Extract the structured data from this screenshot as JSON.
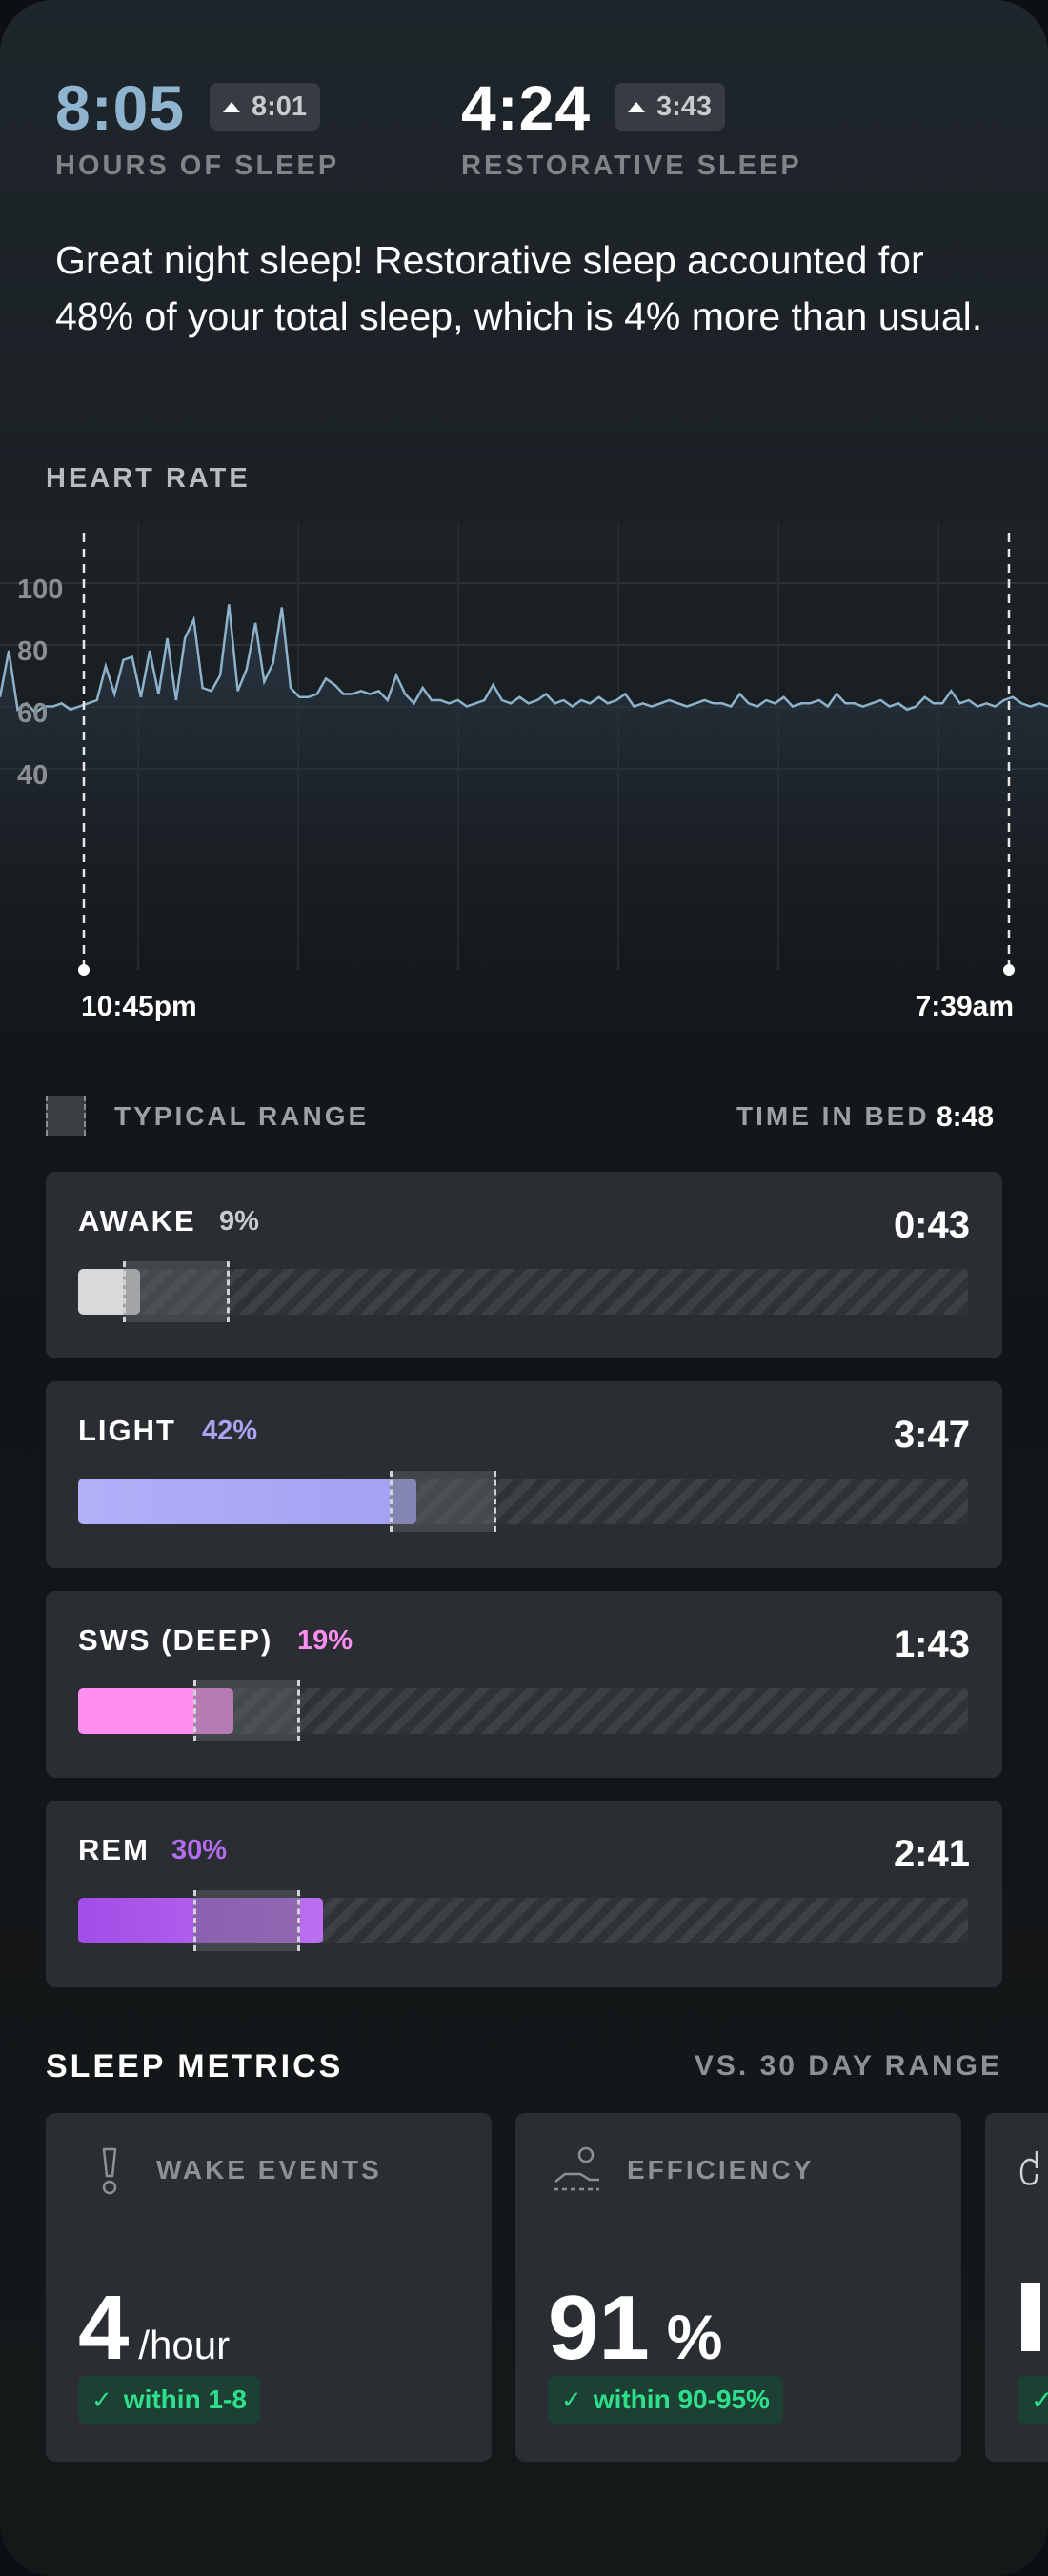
{
  "header": {
    "sleep": {
      "value": "8:05",
      "badge": "8:01",
      "label": "HOURS OF SLEEP"
    },
    "restorative": {
      "value": "4:24",
      "badge": "3:43",
      "label": "RESTORATIVE SLEEP"
    },
    "summary": "Great night sleep! Restorative sleep accounted for 48% of your total sleep, which is 4% more than usual."
  },
  "heart_rate": {
    "title": "HEART RATE",
    "start_label": "10:45pm",
    "end_label": "7:39am"
  },
  "chart_data": {
    "type": "line",
    "title": "HEART RATE",
    "xlabel": "",
    "ylabel": "",
    "x_labels": [
      "10:45pm",
      "7:39am"
    ],
    "y_ticks": [
      100,
      80,
      60,
      40
    ],
    "ylim": [
      36,
      108
    ],
    "grid": true,
    "series": [
      {
        "values": [
          65,
          80,
          61,
          63,
          60,
          62,
          62,
          63,
          61,
          62,
          63,
          64,
          75,
          66,
          77,
          78,
          65,
          80,
          66,
          84,
          64,
          84,
          90,
          68,
          67,
          72,
          95,
          67,
          74,
          89,
          70,
          76,
          94,
          68,
          65,
          65,
          66,
          71,
          69,
          66,
          66,
          67,
          66,
          67,
          64,
          72,
          66,
          63,
          68,
          64,
          64,
          63,
          64,
          62,
          63,
          64,
          69,
          64,
          63,
          65,
          63,
          64,
          66,
          63,
          64,
          62,
          64,
          63,
          65,
          63,
          64,
          66,
          62,
          63,
          62,
          63,
          64,
          63,
          62,
          63,
          64,
          63,
          63,
          62,
          66,
          63,
          62,
          64,
          63,
          65,
          62,
          63,
          63,
          64,
          62,
          66,
          63,
          63,
          62,
          63,
          64,
          62,
          63,
          61,
          62,
          65,
          63,
          63,
          67,
          63,
          64,
          62,
          63,
          62,
          64,
          65,
          63,
          62,
          63,
          62
        ]
      }
    ]
  },
  "legend": {
    "typical_range": "TYPICAL RANGE",
    "time_in_bed_label": "TIME IN BED",
    "time_in_bed_value": "8:48"
  },
  "stages": [
    {
      "name": "AWAKE",
      "pct": "9%",
      "time": "0:43",
      "fill": 0.07,
      "range": [
        0.05,
        0.17
      ],
      "pct_color": "#c9ccce",
      "fill_color": "#d9d9d9"
    },
    {
      "name": "LIGHT",
      "pct": "42%",
      "time": "3:47",
      "fill": 0.38,
      "range": [
        0.35,
        0.47
      ],
      "pct_color": "#a9a3f2",
      "fill_color": "#a9a6f6"
    },
    {
      "name": "SWS (DEEP)",
      "pct": "19%",
      "time": "1:43",
      "fill": 0.175,
      "range": [
        0.13,
        0.25
      ],
      "pct_color": "#ff8ef0",
      "fill_color": "#ff8ef0"
    },
    {
      "name": "REM",
      "pct": "30%",
      "time": "2:41",
      "fill": 0.275,
      "range": [
        0.13,
        0.25
      ],
      "pct_color": "#b36df0",
      "fill_color": "#a44ee8"
    }
  ],
  "metrics": {
    "title": "SLEEP METRICS",
    "subtitle": "VS. 30 DAY RANGE",
    "cards": [
      {
        "label": "WAKE EVENTS",
        "value": "4",
        "unit": "/hour",
        "badge": "within 1-8",
        "icon": "exclamation-icon"
      },
      {
        "label": "EFFICIENCY",
        "value": "91",
        "unit": "%",
        "badge": "within 90-95%",
        "icon": "sleeper-icon"
      }
    ]
  }
}
